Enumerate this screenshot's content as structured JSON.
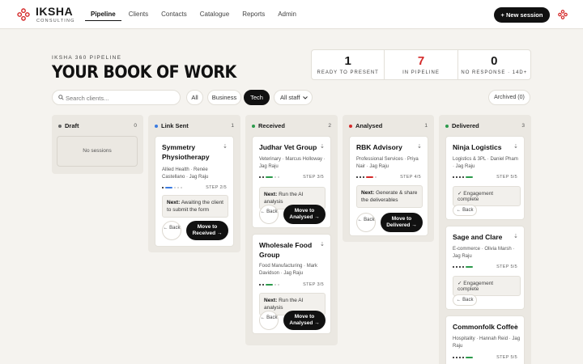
{
  "brand": {
    "name": "IKSHA",
    "sub": "CONSULTING"
  },
  "nav": {
    "items": [
      "Pipeline",
      "Clients",
      "Contacts",
      "Catalogue",
      "Reports",
      "Admin"
    ],
    "active": "Pipeline"
  },
  "header": {
    "new_session": "+ New session"
  },
  "page": {
    "eyebrow": "IKSHA 360 PIPELINE",
    "title": "YOUR BOOK OF WORK"
  },
  "stats": [
    {
      "value": "1",
      "label": "READY TO PRESENT"
    },
    {
      "value": "7",
      "label": "IN PIPELINE"
    },
    {
      "value": "0",
      "label": "NO RESPONSE · 14D+"
    }
  ],
  "filters": {
    "search_placeholder": "Search clients...",
    "chips": [
      "All",
      "Business",
      "Tech"
    ],
    "active_chip": "Tech",
    "staff": "All staff",
    "archived": "Archived (0)"
  },
  "colors": {
    "accent": "#111111",
    "link_sent": "#3b7be0",
    "received": "#2c9a4b",
    "analysed": "#d42a2a",
    "delivered": "#2c9a4b",
    "draft": "#666666"
  },
  "columns": [
    {
      "name": "Draft",
      "count": "0",
      "empty": "No sessions",
      "cards": []
    },
    {
      "name": "Link Sent",
      "count": "1",
      "cards": [
        {
          "title": "Symmetry Physiotherapy",
          "meta": "Allied Health · Renée Castellano · Jag Raju",
          "step": "STEP 2/5",
          "next_label": "Next:",
          "next": "Awaiting the client to submit the form",
          "back": "← Back",
          "move": "Move to Received →"
        }
      ]
    },
    {
      "name": "Received",
      "count": "2",
      "cards": [
        {
          "title": "Judhar Vet Group",
          "meta": "Veterinary · Marcus Holloway · Jag Raju",
          "step": "STEP 3/5",
          "next_label": "Next:",
          "next": "Run the AI analysis",
          "back": "← Back",
          "move": "Move to Analysed →"
        },
        {
          "title": "Wholesale Food Group",
          "meta": "Food Manufacturing · Mark Davidson · Jag Raju",
          "step": "STEP 3/5",
          "next_label": "Next:",
          "next": "Run the AI analysis",
          "back": "← Back",
          "move": "Move to Analysed →"
        }
      ]
    },
    {
      "name": "Analysed",
      "count": "1",
      "cards": [
        {
          "title": "RBK Advisory",
          "meta": "Professional Services · Priya Nair · Jag Raju",
          "step": "STEP 4/5",
          "next_label": "Next:",
          "next": "Generate & share the deliverables",
          "back": "← Back",
          "move": "Move to Delivered →"
        }
      ]
    },
    {
      "name": "Delivered",
      "count": "3",
      "cards": [
        {
          "title": "Ninja Logistics",
          "meta": "Logistics & 3PL · Daniel Pham · Jag Raju",
          "step": "STEP 5/5",
          "done": "✓ Engagement complete",
          "back": "← Back"
        },
        {
          "title": "Sage and Clare",
          "meta": "E-commerce · Olivia Marsh · Jag Raju",
          "step": "STEP 5/5",
          "done": "✓ Engagement complete",
          "back": "← Back"
        },
        {
          "title": "Commonfolk Coffee",
          "meta": "Hospitality · Hannah Reid · Jag Raju",
          "step": "STEP 5/5"
        }
      ]
    }
  ]
}
